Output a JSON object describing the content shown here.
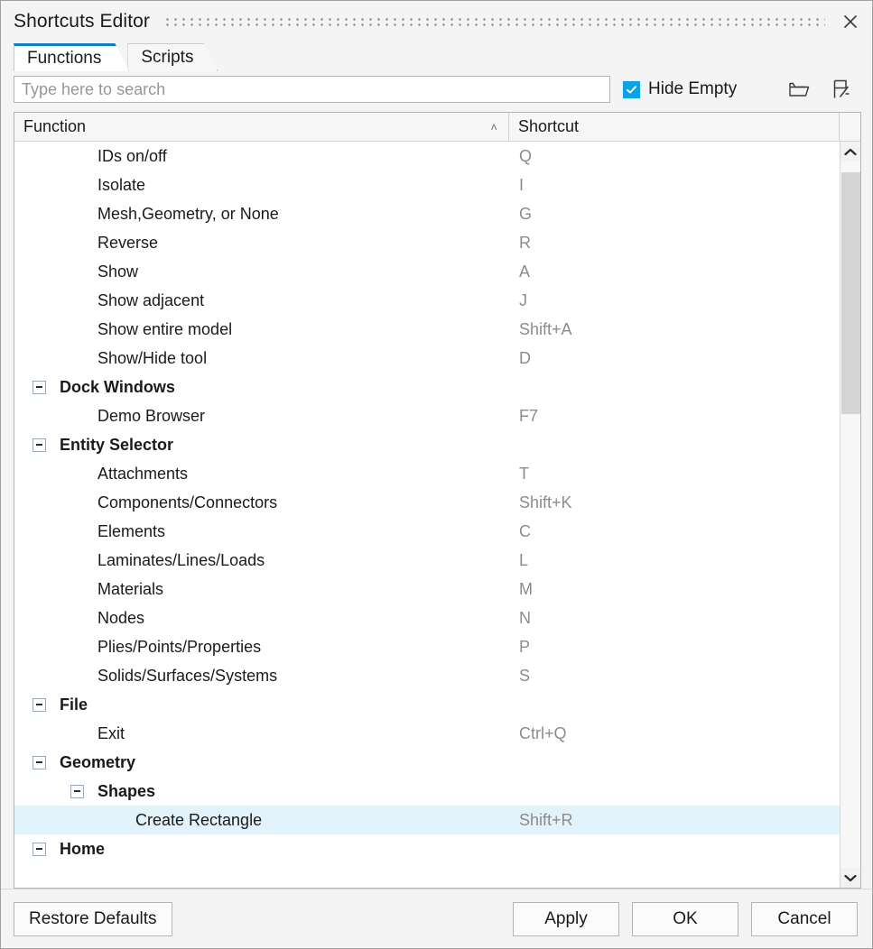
{
  "window": {
    "title": "Shortcuts Editor",
    "close_icon": "close-icon",
    "drag_handle": "dotted-drag-handle"
  },
  "tabs": [
    {
      "label": "Functions",
      "active": true
    },
    {
      "label": "Scripts",
      "active": false
    }
  ],
  "search": {
    "value": "",
    "placeholder": "Type here to search"
  },
  "hide_empty": {
    "label": "Hide Empty",
    "checked": true,
    "accent_color": "#0aa3e6"
  },
  "header_icons": [
    {
      "name": "folder-open-icon"
    },
    {
      "name": "save-document-icon"
    }
  ],
  "table": {
    "columns": [
      {
        "label": "Function",
        "sort": "ascending",
        "sort_caret": "˄"
      },
      {
        "label": "Shortcut"
      }
    ],
    "selection_color": "#e2f3fb",
    "rows": [
      {
        "type": "item",
        "level": 1,
        "label": "IDs on/off",
        "shortcut": "Q"
      },
      {
        "type": "item",
        "level": 1,
        "label": "Isolate",
        "shortcut": "I"
      },
      {
        "type": "item",
        "level": 1,
        "label": "Mesh,Geometry, or None",
        "shortcut": "G"
      },
      {
        "type": "item",
        "level": 1,
        "label": "Reverse",
        "shortcut": "R"
      },
      {
        "type": "item",
        "level": 1,
        "label": "Show",
        "shortcut": "A"
      },
      {
        "type": "item",
        "level": 1,
        "label": "Show adjacent",
        "shortcut": "J"
      },
      {
        "type": "item",
        "level": 1,
        "label": "Show entire model",
        "shortcut": "Shift+A"
      },
      {
        "type": "item",
        "level": 1,
        "label": "Show/Hide tool",
        "shortcut": "D"
      },
      {
        "type": "group",
        "level": 0,
        "label": "Dock Windows",
        "shortcut": ""
      },
      {
        "type": "item",
        "level": 1,
        "label": "Demo Browser",
        "shortcut": "F7"
      },
      {
        "type": "group",
        "level": 0,
        "label": "Entity Selector",
        "shortcut": ""
      },
      {
        "type": "item",
        "level": 1,
        "label": "Attachments",
        "shortcut": "T"
      },
      {
        "type": "item",
        "level": 1,
        "label": "Components/Connectors",
        "shortcut": "Shift+K"
      },
      {
        "type": "item",
        "level": 1,
        "label": "Elements",
        "shortcut": "C"
      },
      {
        "type": "item",
        "level": 1,
        "label": "Laminates/Lines/Loads",
        "shortcut": "L"
      },
      {
        "type": "item",
        "level": 1,
        "label": "Materials",
        "shortcut": "M"
      },
      {
        "type": "item",
        "level": 1,
        "label": "Nodes",
        "shortcut": "N"
      },
      {
        "type": "item",
        "level": 1,
        "label": "Plies/Points/Properties",
        "shortcut": "P"
      },
      {
        "type": "item",
        "level": 1,
        "label": "Solids/Surfaces/Systems",
        "shortcut": "S"
      },
      {
        "type": "group",
        "level": 0,
        "label": "File",
        "shortcut": ""
      },
      {
        "type": "item",
        "level": 1,
        "label": "Exit",
        "shortcut": "Ctrl+Q"
      },
      {
        "type": "group",
        "level": 0,
        "label": "Geometry",
        "shortcut": ""
      },
      {
        "type": "group",
        "level": 1,
        "label": "Shapes",
        "shortcut": ""
      },
      {
        "type": "item",
        "level": 2,
        "label": "Create Rectangle",
        "shortcut": "Shift+R",
        "selected": true
      },
      {
        "type": "group",
        "level": 0,
        "label": "Home",
        "shortcut": ""
      }
    ]
  },
  "scrollbar": {
    "up_arrow": "chevron-up-icon",
    "down_arrow": "chevron-down-icon"
  },
  "footer": {
    "restore_defaults": "Restore Defaults",
    "apply": "Apply",
    "ok": "OK",
    "cancel": "Cancel"
  }
}
